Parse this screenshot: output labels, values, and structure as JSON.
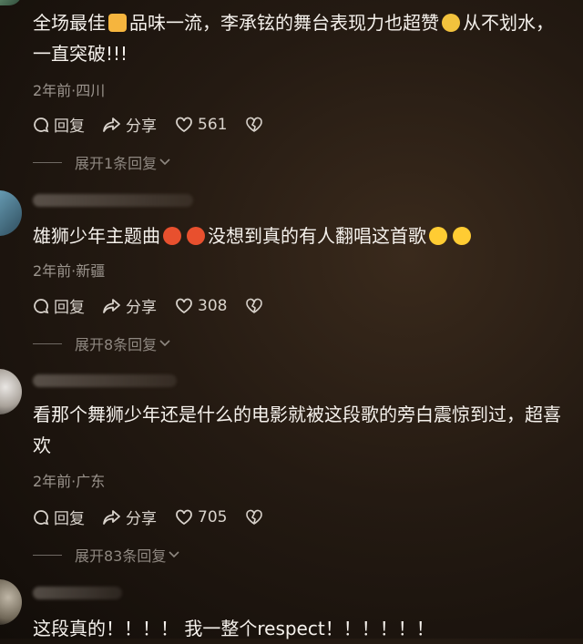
{
  "comments": [
    {
      "text_a": "全场最佳",
      "emoji_1": "thumbs-up-icon",
      "text_b": "品味一流，李承铉的舞台表现力也超赞",
      "emoji_2": "clapping-hands-icon",
      "text_c": "从不划水，一直突破!!!",
      "meta": "2年前·四川",
      "reply_label": "回复",
      "share_label": "分享",
      "likes": "561",
      "expand": "展开1条回复"
    },
    {
      "text_a": "雄狮少年主题曲",
      "emoji_1": "star-struck-icon",
      "text_b": "没想到真的有人翻唱这首歌",
      "emoji_2": "crying-face-icon",
      "meta": "2年前·新疆",
      "reply_label": "回复",
      "share_label": "分享",
      "likes": "308",
      "expand": "展开8条回复"
    },
    {
      "text_a": "看那个舞狮少年还是什么的电影就被这段歌的旁白震惊到过，超喜欢",
      "meta": "2年前·广东",
      "reply_label": "回复",
      "share_label": "分享",
      "likes": "705",
      "expand": "展开83条回复"
    },
    {
      "text_a": "这段真的！！！！ 我一整个respect！！！！！！"
    }
  ],
  "colors": {
    "text": "#f5f1ec",
    "meta": "#9b948d",
    "muted": "#8f8881"
  }
}
